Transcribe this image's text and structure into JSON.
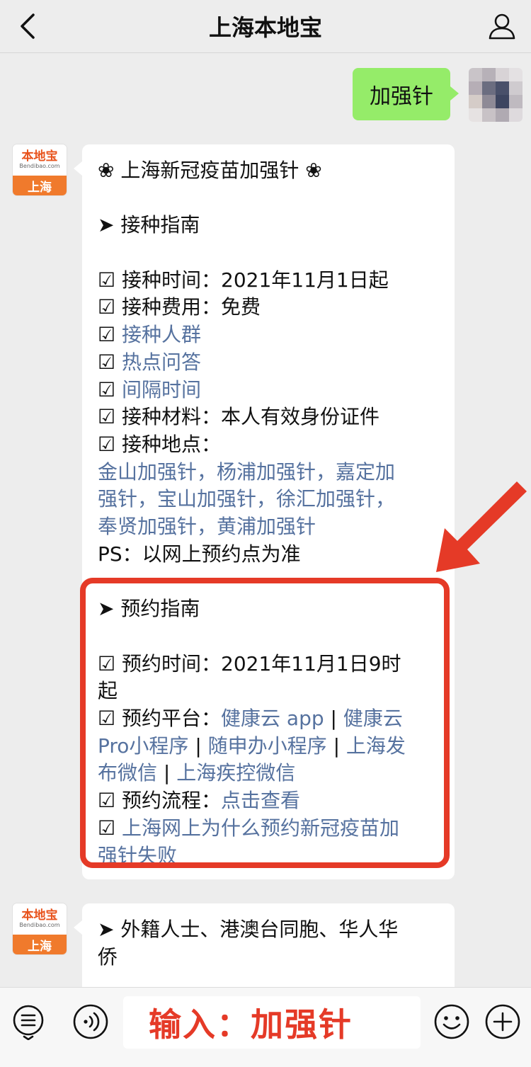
{
  "nav": {
    "title": "上海本地宝",
    "back_icon": "chevron-left-icon",
    "profile_icon": "person-icon"
  },
  "outgoing": {
    "text": "加强针"
  },
  "bot": {
    "avatar_name": "本地宝",
    "avatar_domain": "Bendibao.com",
    "avatar_city": "上海"
  },
  "message1": {
    "title": "❀ 上海新冠疫苗加强针 ❀",
    "section1_heading": "➤ 接种指南",
    "time": "☑ 接种时间：2021年11月1日起",
    "cost": "☑ 接种费用：免费",
    "crowd_check": "☑ ",
    "crowd_link": "接种人群",
    "faq_check": "☑ ",
    "faq_link": "热点问答",
    "interval_check": "☑ ",
    "interval_link": "间隔时间",
    "materials": "☑ 接种材料：本人有效身份证件",
    "location": "☑ 接种地点：",
    "districts_line1": "金山加强针，杨浦加强针，嘉定加",
    "districts_line2": "强针，宝山加强针，徐汇加强针，",
    "districts_line3": "奉贤加强针，黄浦加强针",
    "ps": "PS：以网上预约点为准",
    "section2_heading": "➤ 预约指南",
    "appt_time_line1": "☑ 预约时间：2021年11月1日9时",
    "appt_time_line2": "起",
    "platform_label": "☑ 预约平台：",
    "platform_link1": "健康云 app",
    "platform_sep1": " | ",
    "platform_link2a": "健康云",
    "platform_link2b": "Pro小程序",
    "platform_sep2": " | ",
    "platform_link3": "随申办小程序",
    "platform_sep3": " | ",
    "platform_link4a": "上海发",
    "platform_link4b": "布微信",
    "platform_sep4": " | ",
    "platform_link5": "上海疾控微信",
    "process_label": "☑ 预约流程：",
    "process_link": "点击查看",
    "failure_check": "☑ ",
    "failure_link_line1": "上海网上为什么预约新冠疫苗加",
    "failure_link_line2": "强针失败"
  },
  "message2": {
    "line1": "➤ 外籍人士、港澳台同胞、华人华",
    "line2": "侨"
  },
  "input": {
    "text": "输入：加强针",
    "voice_icon": "voice-icon",
    "menu_icon": "menu-icon",
    "emoji_icon": "emoji-icon",
    "plus_icon": "plus-icon"
  },
  "colors": {
    "accent_red": "#e53a27",
    "link_blue": "#56729f",
    "bubble_green": "#95ec69"
  }
}
